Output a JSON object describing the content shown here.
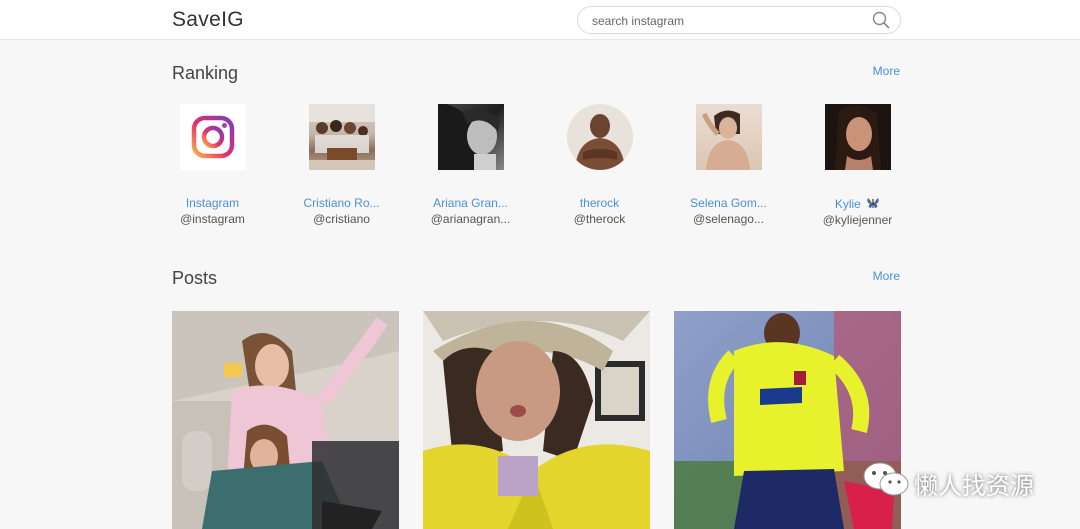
{
  "app": {
    "logo": "SaveIG"
  },
  "search": {
    "placeholder": "search instagram"
  },
  "ranking": {
    "title": "Ranking",
    "more_label": "More",
    "items": [
      {
        "name": "Instagram",
        "handle": "@instagram"
      },
      {
        "name": "Cristiano Ro...",
        "handle": "@cristiano"
      },
      {
        "name": "Ariana Gran...",
        "handle": "@arianagran..."
      },
      {
        "name": "therock",
        "handle": "@therock"
      },
      {
        "name": "Selena Gom...",
        "handle": "@selenago..."
      },
      {
        "name": "Kylie",
        "handle": "@kyliejenner"
      }
    ]
  },
  "posts": {
    "title": "Posts",
    "more_label": "More"
  },
  "watermark": {
    "text": "懒人找资源"
  },
  "colors": {
    "link": "#4a90d9",
    "background": "#f7f7f7",
    "topbar": "#ffffff"
  }
}
